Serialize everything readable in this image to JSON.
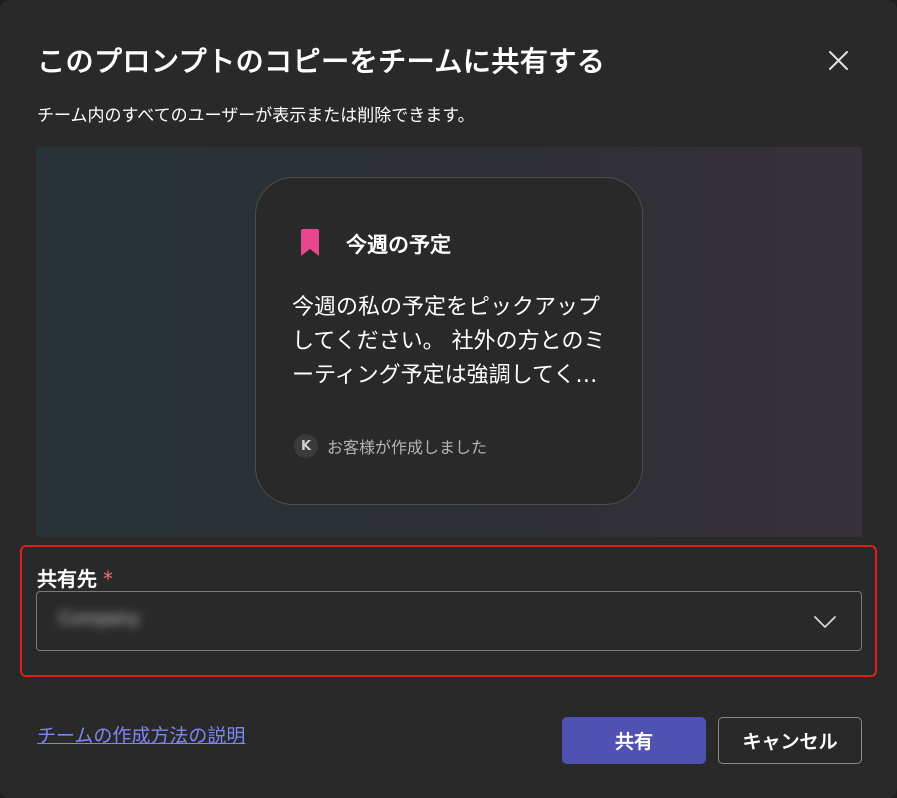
{
  "dialog": {
    "title": "このプロンプトのコピーをチームに共有する",
    "subtitle": "チーム内のすべてのユーザーが表示または削除できます。",
    "close_icon": "close-icon"
  },
  "preview_card": {
    "icon": "bookmark-icon",
    "icon_color": "#e8468f",
    "title": "今週の予定",
    "body": "今週の私の予定をピックアップしてください。 社外の方とのミーティング予定は強調してください。",
    "author_initial": "K",
    "author_text": "お客様が作成しました"
  },
  "share": {
    "label": "共有先",
    "required_mark": "*",
    "selected_value": "Company",
    "chevron_icon": "chevron-down-icon"
  },
  "footer": {
    "help_link": "チームの作成方法の説明",
    "share_button": "共有",
    "cancel_button": "キャンセル"
  },
  "colors": {
    "accent": "#4f52b2",
    "link": "#7f85f5",
    "required": "#f1707b",
    "highlight_border": "#e01e1e"
  }
}
